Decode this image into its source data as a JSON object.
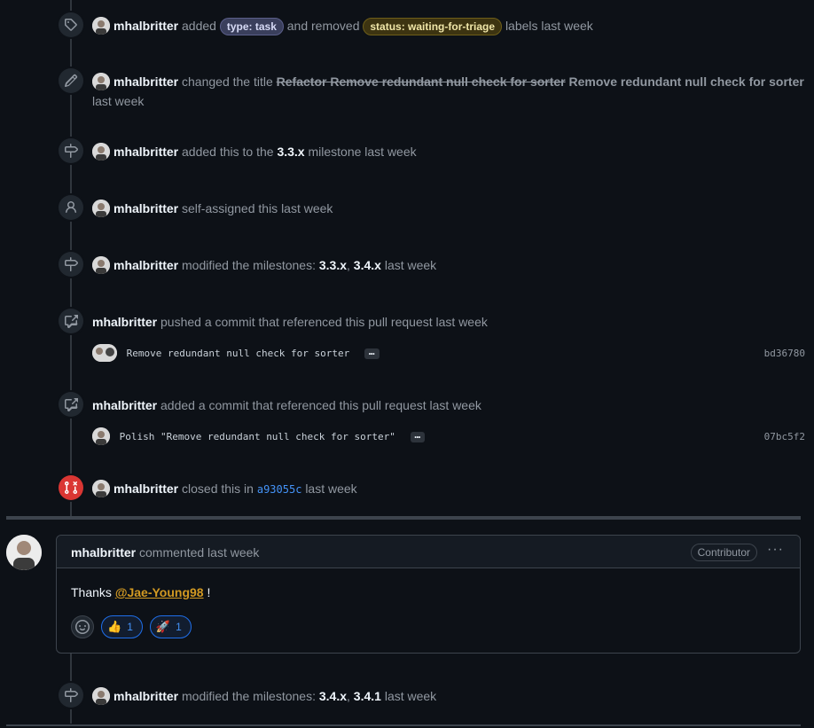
{
  "events": [
    {
      "user": "mhalbritter",
      "pre": "added",
      "label1": "type: task",
      "mid": "and removed",
      "label2": "status: waiting-for-triage",
      "post": "labels last week"
    },
    {
      "user": "mhalbritter",
      "pre": "changed the title",
      "old": "Refactor Remove redundant null check for sorter",
      "new": "Remove redundant null check for sorter",
      "post": "last week"
    },
    {
      "user": "mhalbritter",
      "pre": "added this to the",
      "milestone": "3.3.x",
      "post": "milestone last week"
    },
    {
      "user": "mhalbritter",
      "text": "self-assigned this last week"
    },
    {
      "user": "mhalbritter",
      "pre": "modified the milestones:",
      "m1": "3.3.x",
      "sep": ",",
      "m2": "3.4.x",
      "post": "last week"
    },
    {
      "user": "mhalbritter",
      "text": "pushed a commit that referenced this pull request last week",
      "commit_msg": "Remove redundant null check for sorter",
      "ellipsis": "…",
      "sha": "bd36780"
    },
    {
      "user": "mhalbritter",
      "text": "added a commit that referenced this pull request last week",
      "commit_msg": "Polish \"Remove redundant null check for sorter\"",
      "ellipsis": "…",
      "sha": "07bc5f2"
    },
    {
      "user": "mhalbritter",
      "pre": "closed this in",
      "sha": "a93055c",
      "post": "last week"
    }
  ],
  "comment": {
    "user": "mhalbritter",
    "action": "commented last week",
    "badge": "Contributor",
    "menu": "···",
    "text_pre": "Thanks",
    "mention": "@Jae-Young98",
    "text_post": "!",
    "reactions": [
      {
        "emoji": "👍",
        "count": "1"
      },
      {
        "emoji": "🚀",
        "count": "1"
      }
    ]
  },
  "last_event": {
    "user": "mhalbritter",
    "pre": "modified the milestones:",
    "m1": "3.4.x",
    "sep": ",",
    "m2": "3.4.1",
    "post": "last week"
  },
  "colors": {
    "bg": "#0d1117",
    "closed": "#da3633",
    "link": "#4493f8",
    "mention": "#d29922"
  },
  "icons": [
    "tag-icon",
    "pencil-icon",
    "milestone-icon",
    "person-icon",
    "milestone-icon",
    "cross-reference-icon",
    "cross-reference-icon",
    "git-pull-request-closed-icon",
    "milestone-icon"
  ]
}
